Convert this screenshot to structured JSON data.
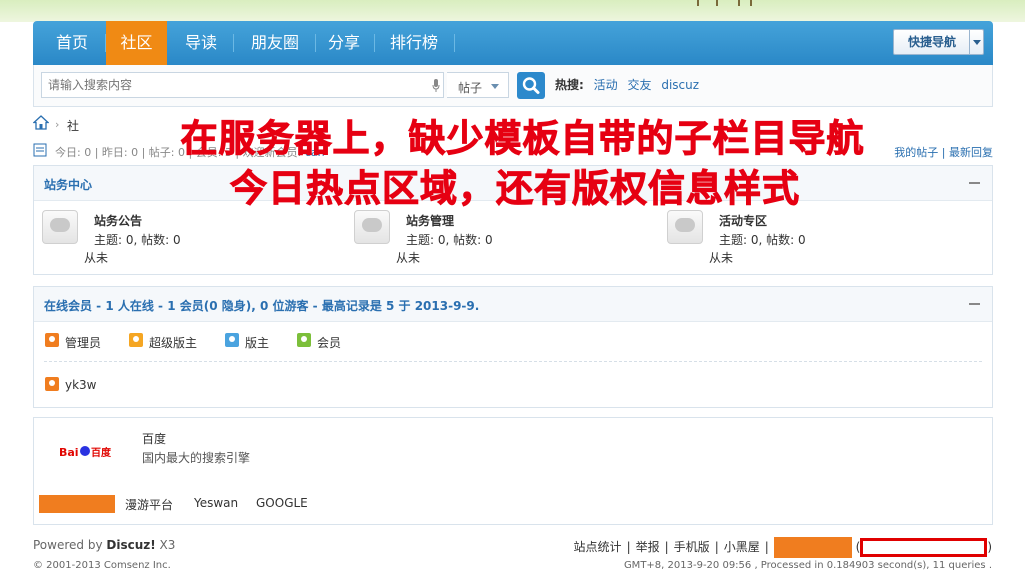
{
  "nav": {
    "items": [
      "首页",
      "社区",
      "导读",
      "朋友圈",
      "分享",
      "排行榜"
    ],
    "active_index": 1,
    "quick_nav_label": "快捷导航"
  },
  "search": {
    "placeholder": "请输入搜索内容",
    "type_label": "帖子",
    "hot_label": "热搜:",
    "hot_terms": [
      "活动",
      "交友",
      "discuz"
    ]
  },
  "breadcrumb": {
    "arrow": "›",
    "text": "社"
  },
  "stats": {
    "text": "今日: 0 | 昨日: 0 | 帖子: 0 | 会员: 3 | 欢迎新会员: ",
    "new_member": "can",
    "links": "我的帖子 | 最新回复"
  },
  "overlay": {
    "line1": "在服务器上，缺少模板自带的子栏目导航",
    "line2": "今日热点区域，还有版权信息样式"
  },
  "forum_group": {
    "title": "站务中心",
    "forums": [
      {
        "name": "站务公告",
        "stats": "主题: 0, 帖数: 0",
        "last": "从未"
      },
      {
        "name": "站务管理",
        "stats": "主题: 0, 帖数: 0",
        "last": "从未"
      },
      {
        "name": "活动专区",
        "stats": "主题: 0, 帖数: 0",
        "last": "从未"
      }
    ]
  },
  "online": {
    "title": "在线会员 - 1 人在线 - 1 会员(0 隐身), 0 位游客 - 最高记录是 5 于 2013-9-9.",
    "legend": [
      {
        "label": "管理员",
        "color": "#f07d1f"
      },
      {
        "label": "超级版主",
        "color": "#f5a623"
      },
      {
        "label": "版主",
        "color": "#4aa3df"
      },
      {
        "label": "会员",
        "color": "#7cbf3a"
      }
    ],
    "users": [
      {
        "name": "yk3w",
        "color": "#f07d1f"
      }
    ]
  },
  "links": {
    "logo_text": "Bai百度",
    "name": "百度",
    "desc": "国内最大的搜索引擎",
    "text_links": [
      "漫游平台",
      "Yeswan",
      "GOOGLE"
    ]
  },
  "footer": {
    "powered_prefix": "Powered by ",
    "powered_name": "Discuz!",
    "powered_version": " X3",
    "copyright": "© 2001-2013 Comsenz Inc.",
    "links": [
      "站点统计",
      "举报",
      "手机版",
      "小黑屋"
    ],
    "paren_open": "(",
    "paren_close": ")",
    "time_text": "GMT+8, 2013-9-20 09:56 , Processed in 0.184903 second(s), 11 queries ."
  }
}
